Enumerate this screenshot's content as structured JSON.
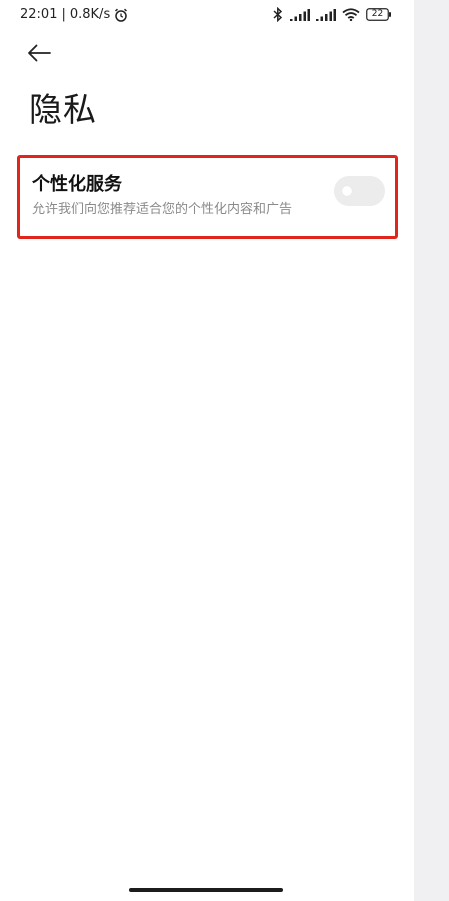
{
  "status_bar": {
    "time": "22:01",
    "separator": "|",
    "network_speed": "0.8K/s",
    "battery_level": "22",
    "icons": [
      "alarm-icon",
      "bluetooth-icon",
      "signal-icon",
      "signal-icon",
      "wifi-icon",
      "battery-icon"
    ]
  },
  "header": {
    "back_icon": "arrow-left-icon",
    "title": "隐私"
  },
  "settings": {
    "items": [
      {
        "title": "个性化服务",
        "description": "允许我们向您推荐适合您的个性化内容和广告",
        "toggle_on": false
      }
    ]
  },
  "colors": {
    "highlight_border": "#e0261c",
    "toggle_off": "#ececec",
    "title_text": "#111111",
    "desc_text": "#8a8a8a"
  }
}
